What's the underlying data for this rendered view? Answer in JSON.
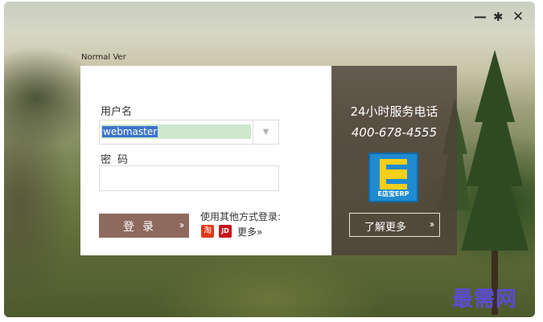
{
  "window": {
    "version_label": "Normal Ver",
    "controls": {
      "minimize_glyph": "—",
      "settings_glyph": "✱",
      "close_glyph": "✕"
    }
  },
  "login": {
    "username_label": "用户名",
    "username_value": "webmaster",
    "dropdown_glyph": "▼",
    "password_label": "密码",
    "password_value": "",
    "login_button": "登录",
    "login_arrow": "››",
    "other_methods_label": "使用其他方式登录:",
    "taobao_icon_text": "淘",
    "jd_icon_text": "JD",
    "more_link": "更多»"
  },
  "panel": {
    "hotline_label": "24小时服务电话",
    "phone_number": "400-678-4555",
    "logo_text": "E店宝ERP",
    "learn_more_button": "了解更多",
    "learn_more_arrow": "››"
  },
  "watermark": "最需网",
  "colors": {
    "login_button_bg": "#8d6a5d",
    "panel_bg": "#4e423a",
    "logo_blue": "#1f8bd0",
    "logo_yellow": "#f6cf1b",
    "username_highlight": "#cde8cf",
    "watermark": "#5b4bd6"
  }
}
